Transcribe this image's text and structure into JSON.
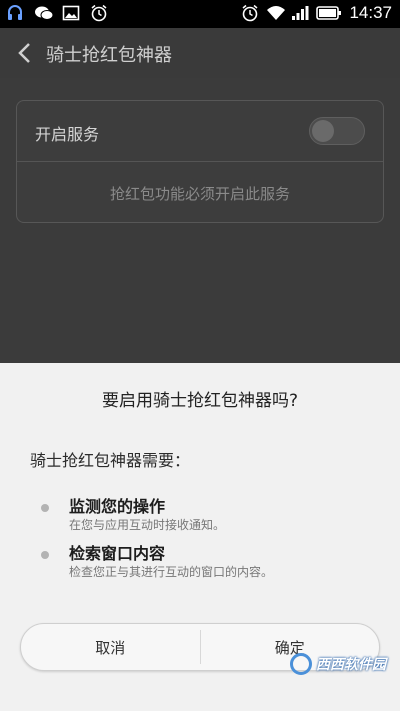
{
  "status_bar": {
    "time": "14:37",
    "icons": [
      "headset-icon",
      "wechat-icon",
      "image-icon",
      "alarm-icon",
      "alarm-icon",
      "wifi-icon",
      "signal-icon",
      "battery-icon"
    ]
  },
  "header": {
    "back_icon": "chevron-left-icon",
    "title": "骑士抢红包神器"
  },
  "settings": {
    "service_label": "开启服务",
    "toggle_state": "off",
    "note": "抢红包功能必须开启此服务"
  },
  "dialog": {
    "title": "要启用骑士抢红包神器吗?",
    "subtitle": "骑士抢红包神器需要：",
    "permissions": [
      {
        "title": "监测您的操作",
        "desc": "在您与应用互动时接收通知。"
      },
      {
        "title": "检索窗口内容",
        "desc": "检查您正与其进行互动的窗口的内容。"
      }
    ],
    "cancel_label": "取消",
    "confirm_label": "确定"
  },
  "watermark": {
    "text": "西西软件园"
  },
  "colors": {
    "dialog_bg": "#f1f1f1",
    "overlay": "#3b3b3b",
    "status_bar": "#000000"
  }
}
